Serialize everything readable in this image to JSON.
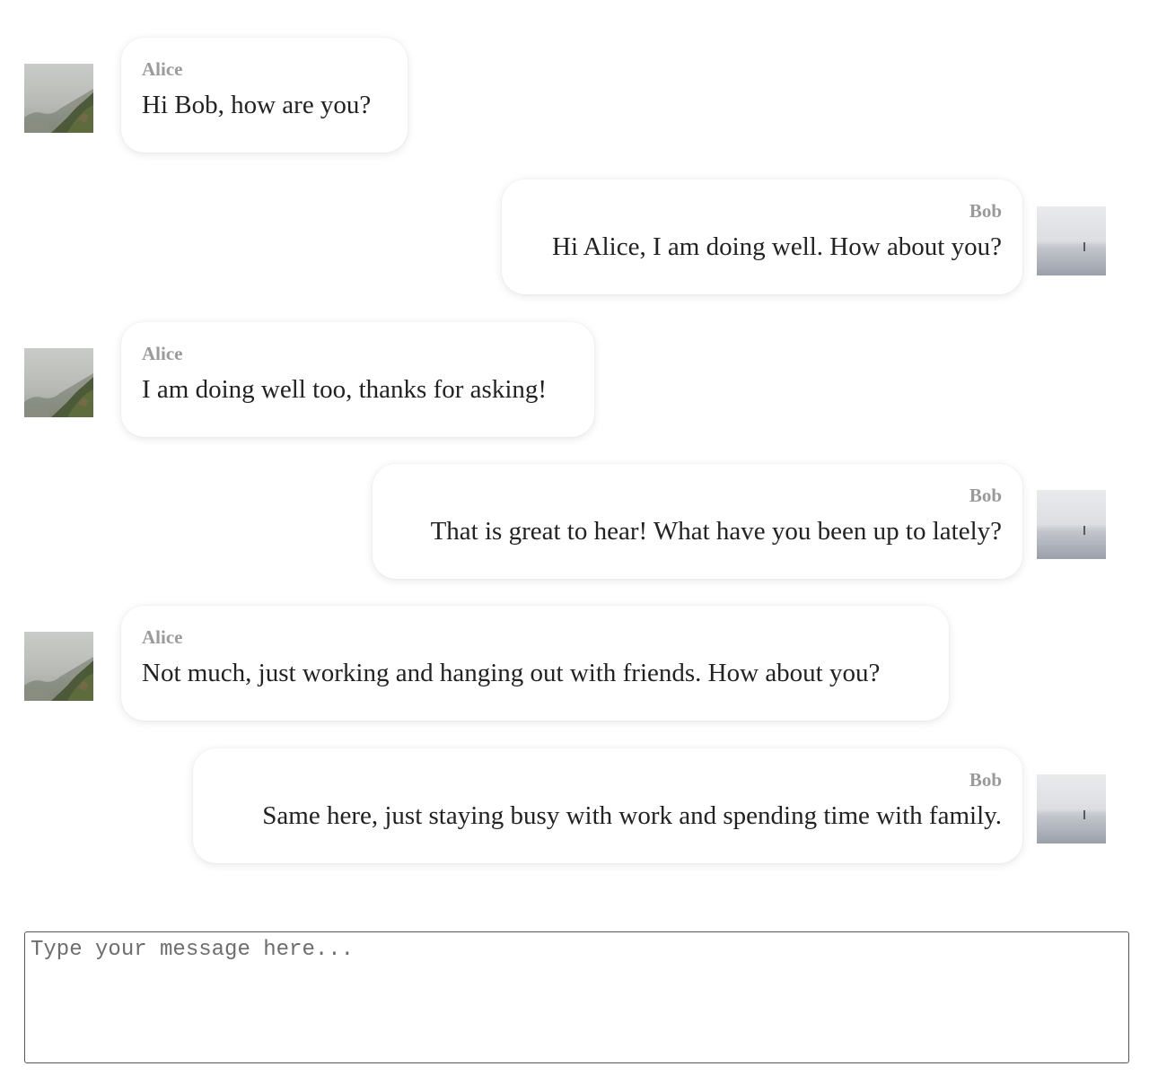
{
  "conversation": {
    "messages": [
      {
        "sender": "Alice",
        "text": "Hi Bob, how are you?",
        "side": "left",
        "avatar_icon": "mountain-fog-photo"
      },
      {
        "sender": "Bob",
        "text": "Hi Alice, I am doing well. How about you?",
        "side": "right",
        "avatar_icon": "sea-horizon-photo"
      },
      {
        "sender": "Alice",
        "text": "I am doing well too, thanks for asking!",
        "side": "left",
        "avatar_icon": "mountain-fog-photo"
      },
      {
        "sender": "Bob",
        "text": "That is great to hear! What have you been up to lately?",
        "side": "right",
        "avatar_icon": "sea-horizon-photo"
      },
      {
        "sender": "Alice",
        "text": "Not much, just working and hanging out with friends. How about you?",
        "side": "left",
        "avatar_icon": "mountain-fog-photo"
      },
      {
        "sender": "Bob",
        "text": "Same here, just staying busy with work and spending time with family.",
        "side": "right",
        "avatar_icon": "sea-horizon-photo"
      }
    ]
  },
  "composer": {
    "placeholder": "Type your message here...",
    "value": ""
  },
  "colors": {
    "sender_name": "#9a9a9a",
    "message_text": "#222222",
    "bubble_background": "#ffffff",
    "composer_border": "#555555"
  }
}
